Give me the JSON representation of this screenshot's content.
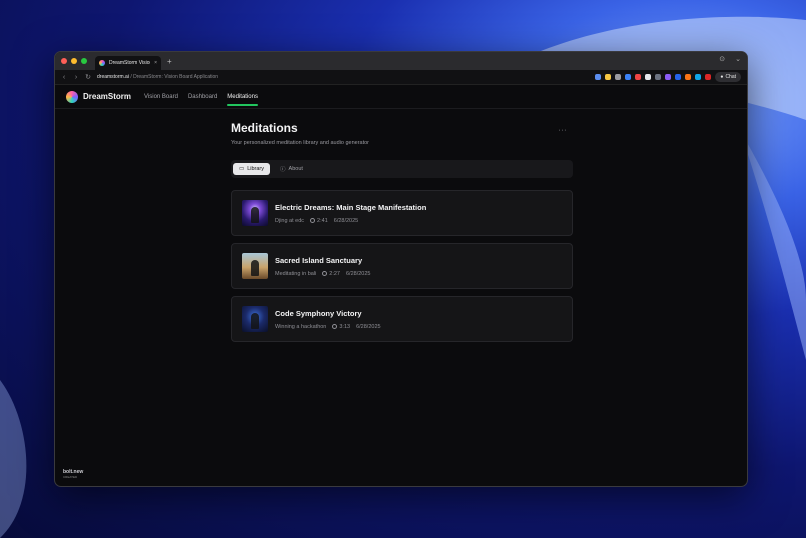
{
  "browser": {
    "tab_title": "DreamStorm Vision Bo",
    "tab_close": "×",
    "new_tab": "+",
    "url_domain": "dreamstorm.ai",
    "url_rest": " / DreamStorm: Vision Board Application",
    "chat_label": "Chat"
  },
  "app": {
    "brand": "DreamStorm",
    "nav": [
      "Vision Board",
      "Dashboard",
      "Meditations"
    ]
  },
  "page": {
    "title": "Meditations",
    "subtitle": "Your personalized meditation library and audio generator",
    "menu": "···",
    "tabs": [
      "Library",
      "About"
    ]
  },
  "meditations": [
    {
      "title": "Electric Dreams: Main Stage Manifestation",
      "desc": "Djing at edc",
      "duration": "2:41",
      "date": "6/28/2025"
    },
    {
      "title": "Sacred Island Sanctuary",
      "desc": "Meditating in bali",
      "duration": "2:27",
      "date": "6/28/2025"
    },
    {
      "title": "Code Symphony Victory",
      "desc": "Winning a hackathon",
      "duration": "3:13",
      "date": "6/28/2025"
    }
  ],
  "footer": {
    "badge": "bolt.new",
    "badge_sub": "CREATED"
  },
  "colors": {
    "accent": "#22c55e",
    "background": "#0b0b0d",
    "card": "#151517"
  }
}
